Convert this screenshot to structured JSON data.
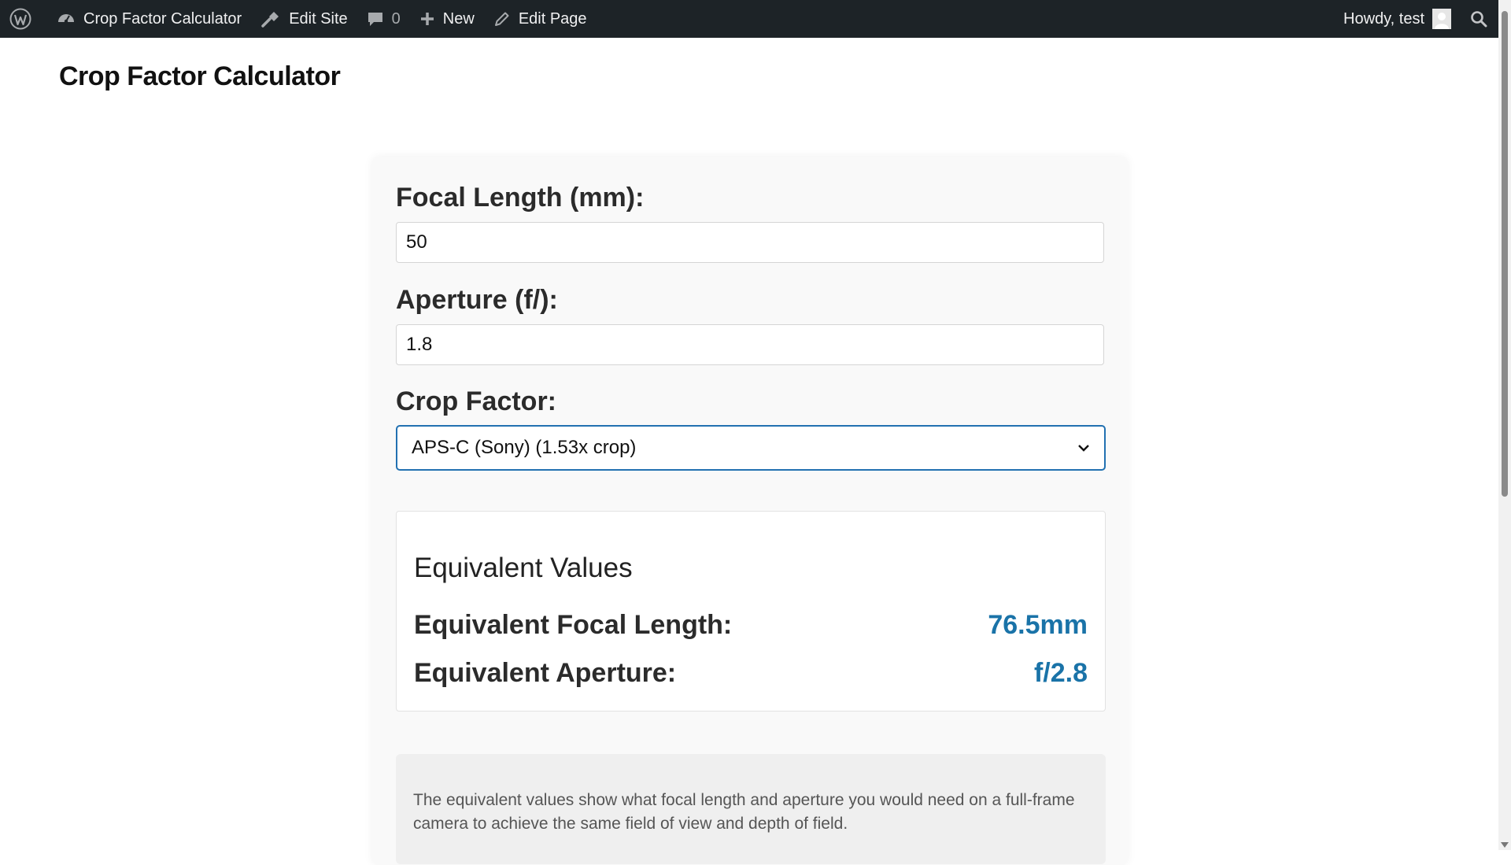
{
  "admin_bar": {
    "site_name": "Crop Factor Calculator",
    "edit_site": "Edit Site",
    "comments_count": "0",
    "new_label": "New",
    "edit_page": "Edit Page",
    "howdy": "Howdy, test"
  },
  "page": {
    "title": "Crop Factor Calculator"
  },
  "form": {
    "focal_length_label": "Focal Length (mm):",
    "focal_length_value": "50",
    "aperture_label": "Aperture (f/):",
    "aperture_value": "1.8",
    "crop_factor_label": "Crop Factor:",
    "crop_factor_selected": "APS-C (Sony) (1.53x crop)"
  },
  "results": {
    "heading": "Equivalent Values",
    "focal_label": "Equivalent Focal Length:",
    "focal_value": "76.5mm",
    "aperture_label": "Equivalent Aperture:",
    "aperture_value": "f/2.8"
  },
  "note": {
    "text": "The equivalent values show what focal length and aperture you would need on a full-frame camera to achieve the same field of view and depth of field."
  },
  "colors": {
    "admin_bar_bg": "#1d2327",
    "accent": "#2271b1",
    "result_value": "#1a73a8"
  },
  "icons": [
    "wordpress-logo-icon",
    "dashboard-icon",
    "edit-site-icon",
    "comment-icon",
    "plus-icon",
    "pencil-icon",
    "avatar-icon",
    "search-icon",
    "chevron-down-icon"
  ]
}
